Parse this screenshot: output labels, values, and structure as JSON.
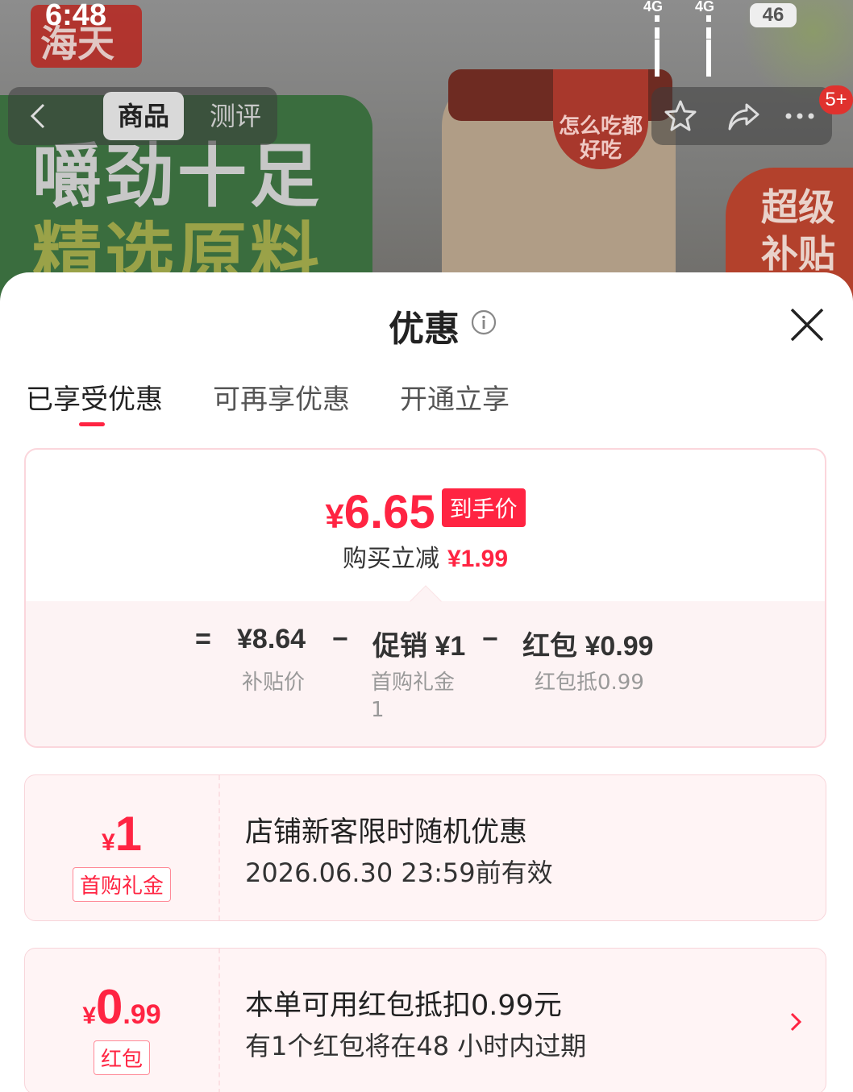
{
  "status_bar": {
    "time": "6:48",
    "signal1": "4G",
    "signal2": "4G",
    "battery": "46"
  },
  "product_nav": {
    "tab_product": "商品",
    "tab_review": "测评",
    "cart_badge": "5+"
  },
  "banner": {
    "logo": "海天",
    "slogan_line1": "嚼劲十足",
    "slogan_line2": "精选原料",
    "jar_tag": "怎么吃都好吃",
    "corner_tag_line1": "超级",
    "corner_tag_line2": "补贴"
  },
  "sheet": {
    "title": "优惠",
    "tabs": [
      "已享受优惠",
      "可再享优惠",
      "开通立享"
    ],
    "active_tab": 0
  },
  "summary": {
    "currency": "¥",
    "final_price": "6.65",
    "final_price_tag": "到手价",
    "cut_label": "购买立减",
    "cut_amount": "¥1.99",
    "eq": "=",
    "subsidy_price": "¥8.64",
    "subsidy_label": "补贴价",
    "minus1": "−",
    "promo": "促销 ¥1",
    "promo_label_line1": "首购礼金",
    "promo_label_line2": "1",
    "minus2": "−",
    "redpacket": "红包 ¥0.99",
    "redpacket_label": "红包抵0.99"
  },
  "coupons": [
    {
      "currency": "¥",
      "value_int": "1",
      "value_dec": "",
      "label": "首购礼金",
      "title": "店铺新客限时随机优惠",
      "subtitle": "2026.06.30 23:59前有效"
    },
    {
      "currency": "¥",
      "value_int": "0",
      "value_dec": ".99",
      "label": "红包",
      "title": "本单可用红包抵扣0.99元",
      "subtitle": "有1个红包将在48 小时内过期"
    }
  ],
  "colors": {
    "accent": "#ff2442",
    "card_bg": "#fff4f5",
    "card_border": "#f8d5da"
  }
}
